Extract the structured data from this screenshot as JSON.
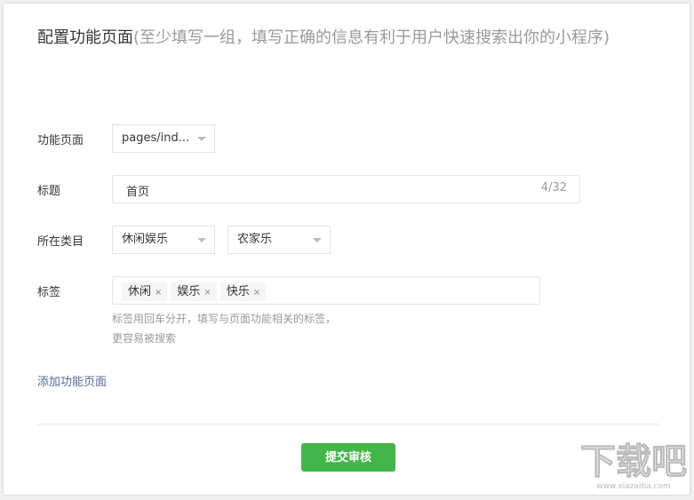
{
  "header": {
    "title": "配置功能页面",
    "subtitle": "(至少填写一组，填写正确的信息有利于用户快速搜索出你的小程序)"
  },
  "form": {
    "page_label": "功能页面",
    "page_value": "pages/ind...",
    "title_label": "标题",
    "title_value": "首页",
    "title_count": "4/32",
    "category_label": "所在类目",
    "category1": "休闲娱乐",
    "category2": "农家乐",
    "tags_label": "标签",
    "tags": [
      "休闲",
      "娱乐",
      "快乐"
    ],
    "tag_remove": "×",
    "hint_line1": "标签用回车分开，填写与页面功能相关的标签，",
    "hint_line2": "更容易被搜索"
  },
  "add_link": "添加功能页面",
  "submit_label": "提交审核",
  "watermark": {
    "logo": "下载吧",
    "url": "www.xiazaiba.com"
  }
}
